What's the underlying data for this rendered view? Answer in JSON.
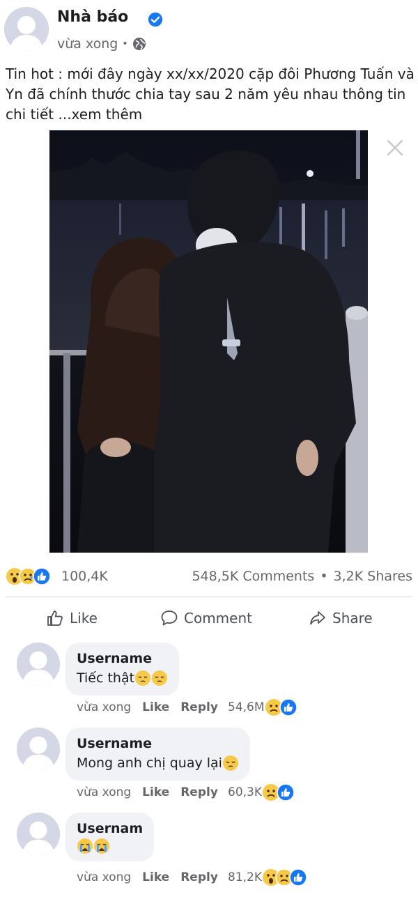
{
  "post": {
    "author": "Nhà báo",
    "time": "vừa xong",
    "dot": "•",
    "text": "Tin hot : mới đây ngày xx/xx/2020 cặp đôi Phương Tuấn và Yn đã chính thước chia tay sau 2 năm yêu nhau thông tin chi tiết ...xem thêm",
    "reactions_count": "100,4K",
    "comments_count": "548,5K Comments",
    "stats_sep": "•",
    "shares_count": "3,2K Shares"
  },
  "actions": {
    "like": "Like",
    "comment": "Comment",
    "share": "Share"
  },
  "comments": [
    {
      "username": "Username",
      "text": "Tiếc thật",
      "time": "vừa xong",
      "like": "Like",
      "reply": "Reply",
      "reactions": "54,6M"
    },
    {
      "username": "Username",
      "text": "Mong anh chị quay lại",
      "time": "vừa xong",
      "like": "Like",
      "reply": "Reply",
      "reactions": "60,3K"
    },
    {
      "username": "Usernam",
      "text": "",
      "time": "vừa xong",
      "like": "Like",
      "reply": "Reply",
      "reactions": "81,2K"
    }
  ],
  "icons": {
    "verified": "verified-badge-icon",
    "privacy": "globe-icon",
    "close": "close-icon",
    "like_action": "thumbs-up-icon",
    "comment_action": "comment-bubble-icon",
    "share_action": "share-arrow-icon",
    "reactions": [
      "wow-reaction-icon",
      "sad-reaction-icon",
      "like-reaction-icon"
    ]
  },
  "colors": {
    "brand_blue": "#1877f2",
    "text_primary": "#1c1e21",
    "text_secondary": "#65676b",
    "bubble_bg": "#f0f2f5",
    "avatar_bg": "#d3d7e6"
  }
}
